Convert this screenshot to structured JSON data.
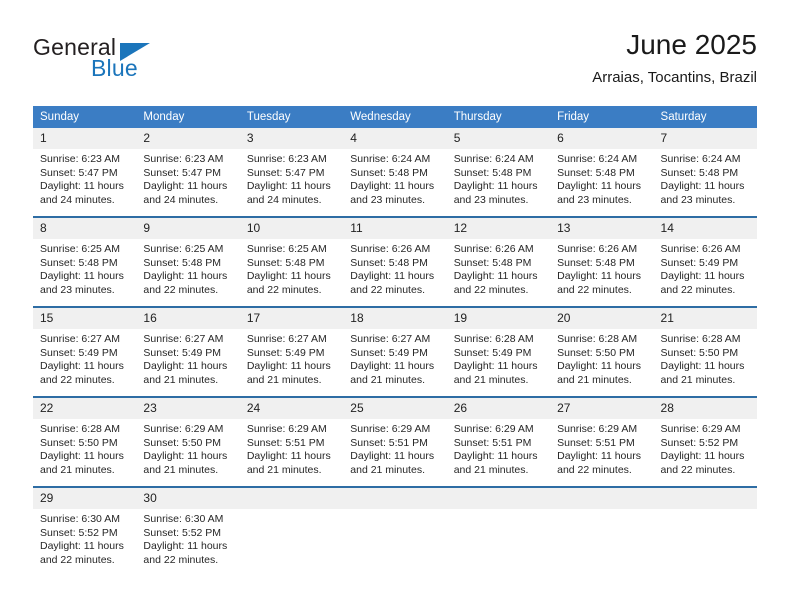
{
  "logo": {
    "word_one": "General",
    "word_two": "Blue",
    "triangle_color": "#1b75bb",
    "text_color": "#231f20"
  },
  "header": {
    "title": "June 2025",
    "subtitle": "Arraias, Tocantins, Brazil"
  },
  "theme": {
    "header_bg": "#3b7dc4",
    "header_text": "#ffffff",
    "row_divider": "#2e6da4",
    "daynum_bg": "#f0f0f0"
  },
  "weekdays": [
    "Sunday",
    "Monday",
    "Tuesday",
    "Wednesday",
    "Thursday",
    "Friday",
    "Saturday"
  ],
  "weeks": [
    [
      {
        "day": "1",
        "sunrise": "Sunrise: 6:23 AM",
        "sunset": "Sunset: 5:47 PM",
        "daylight": "Daylight: 11 hours and 24 minutes."
      },
      {
        "day": "2",
        "sunrise": "Sunrise: 6:23 AM",
        "sunset": "Sunset: 5:47 PM",
        "daylight": "Daylight: 11 hours and 24 minutes."
      },
      {
        "day": "3",
        "sunrise": "Sunrise: 6:23 AM",
        "sunset": "Sunset: 5:47 PM",
        "daylight": "Daylight: 11 hours and 24 minutes."
      },
      {
        "day": "4",
        "sunrise": "Sunrise: 6:24 AM",
        "sunset": "Sunset: 5:48 PM",
        "daylight": "Daylight: 11 hours and 23 minutes."
      },
      {
        "day": "5",
        "sunrise": "Sunrise: 6:24 AM",
        "sunset": "Sunset: 5:48 PM",
        "daylight": "Daylight: 11 hours and 23 minutes."
      },
      {
        "day": "6",
        "sunrise": "Sunrise: 6:24 AM",
        "sunset": "Sunset: 5:48 PM",
        "daylight": "Daylight: 11 hours and 23 minutes."
      },
      {
        "day": "7",
        "sunrise": "Sunrise: 6:24 AM",
        "sunset": "Sunset: 5:48 PM",
        "daylight": "Daylight: 11 hours and 23 minutes."
      }
    ],
    [
      {
        "day": "8",
        "sunrise": "Sunrise: 6:25 AM",
        "sunset": "Sunset: 5:48 PM",
        "daylight": "Daylight: 11 hours and 23 minutes."
      },
      {
        "day": "9",
        "sunrise": "Sunrise: 6:25 AM",
        "sunset": "Sunset: 5:48 PM",
        "daylight": "Daylight: 11 hours and 22 minutes."
      },
      {
        "day": "10",
        "sunrise": "Sunrise: 6:25 AM",
        "sunset": "Sunset: 5:48 PM",
        "daylight": "Daylight: 11 hours and 22 minutes."
      },
      {
        "day": "11",
        "sunrise": "Sunrise: 6:26 AM",
        "sunset": "Sunset: 5:48 PM",
        "daylight": "Daylight: 11 hours and 22 minutes."
      },
      {
        "day": "12",
        "sunrise": "Sunrise: 6:26 AM",
        "sunset": "Sunset: 5:48 PM",
        "daylight": "Daylight: 11 hours and 22 minutes."
      },
      {
        "day": "13",
        "sunrise": "Sunrise: 6:26 AM",
        "sunset": "Sunset: 5:48 PM",
        "daylight": "Daylight: 11 hours and 22 minutes."
      },
      {
        "day": "14",
        "sunrise": "Sunrise: 6:26 AM",
        "sunset": "Sunset: 5:49 PM",
        "daylight": "Daylight: 11 hours and 22 minutes."
      }
    ],
    [
      {
        "day": "15",
        "sunrise": "Sunrise: 6:27 AM",
        "sunset": "Sunset: 5:49 PM",
        "daylight": "Daylight: 11 hours and 22 minutes."
      },
      {
        "day": "16",
        "sunrise": "Sunrise: 6:27 AM",
        "sunset": "Sunset: 5:49 PM",
        "daylight": "Daylight: 11 hours and 21 minutes."
      },
      {
        "day": "17",
        "sunrise": "Sunrise: 6:27 AM",
        "sunset": "Sunset: 5:49 PM",
        "daylight": "Daylight: 11 hours and 21 minutes."
      },
      {
        "day": "18",
        "sunrise": "Sunrise: 6:27 AM",
        "sunset": "Sunset: 5:49 PM",
        "daylight": "Daylight: 11 hours and 21 minutes."
      },
      {
        "day": "19",
        "sunrise": "Sunrise: 6:28 AM",
        "sunset": "Sunset: 5:49 PM",
        "daylight": "Daylight: 11 hours and 21 minutes."
      },
      {
        "day": "20",
        "sunrise": "Sunrise: 6:28 AM",
        "sunset": "Sunset: 5:50 PM",
        "daylight": "Daylight: 11 hours and 21 minutes."
      },
      {
        "day": "21",
        "sunrise": "Sunrise: 6:28 AM",
        "sunset": "Sunset: 5:50 PM",
        "daylight": "Daylight: 11 hours and 21 minutes."
      }
    ],
    [
      {
        "day": "22",
        "sunrise": "Sunrise: 6:28 AM",
        "sunset": "Sunset: 5:50 PM",
        "daylight": "Daylight: 11 hours and 21 minutes."
      },
      {
        "day": "23",
        "sunrise": "Sunrise: 6:29 AM",
        "sunset": "Sunset: 5:50 PM",
        "daylight": "Daylight: 11 hours and 21 minutes."
      },
      {
        "day": "24",
        "sunrise": "Sunrise: 6:29 AM",
        "sunset": "Sunset: 5:51 PM",
        "daylight": "Daylight: 11 hours and 21 minutes."
      },
      {
        "day": "25",
        "sunrise": "Sunrise: 6:29 AM",
        "sunset": "Sunset: 5:51 PM",
        "daylight": "Daylight: 11 hours and 21 minutes."
      },
      {
        "day": "26",
        "sunrise": "Sunrise: 6:29 AM",
        "sunset": "Sunset: 5:51 PM",
        "daylight": "Daylight: 11 hours and 21 minutes."
      },
      {
        "day": "27",
        "sunrise": "Sunrise: 6:29 AM",
        "sunset": "Sunset: 5:51 PM",
        "daylight": "Daylight: 11 hours and 22 minutes."
      },
      {
        "day": "28",
        "sunrise": "Sunrise: 6:29 AM",
        "sunset": "Sunset: 5:52 PM",
        "daylight": "Daylight: 11 hours and 22 minutes."
      }
    ],
    [
      {
        "day": "29",
        "sunrise": "Sunrise: 6:30 AM",
        "sunset": "Sunset: 5:52 PM",
        "daylight": "Daylight: 11 hours and 22 minutes."
      },
      {
        "day": "30",
        "sunrise": "Sunrise: 6:30 AM",
        "sunset": "Sunset: 5:52 PM",
        "daylight": "Daylight: 11 hours and 22 minutes."
      },
      {
        "day": "",
        "sunrise": "",
        "sunset": "",
        "daylight": ""
      },
      {
        "day": "",
        "sunrise": "",
        "sunset": "",
        "daylight": ""
      },
      {
        "day": "",
        "sunrise": "",
        "sunset": "",
        "daylight": ""
      },
      {
        "day": "",
        "sunrise": "",
        "sunset": "",
        "daylight": ""
      },
      {
        "day": "",
        "sunrise": "",
        "sunset": "",
        "daylight": ""
      }
    ]
  ]
}
